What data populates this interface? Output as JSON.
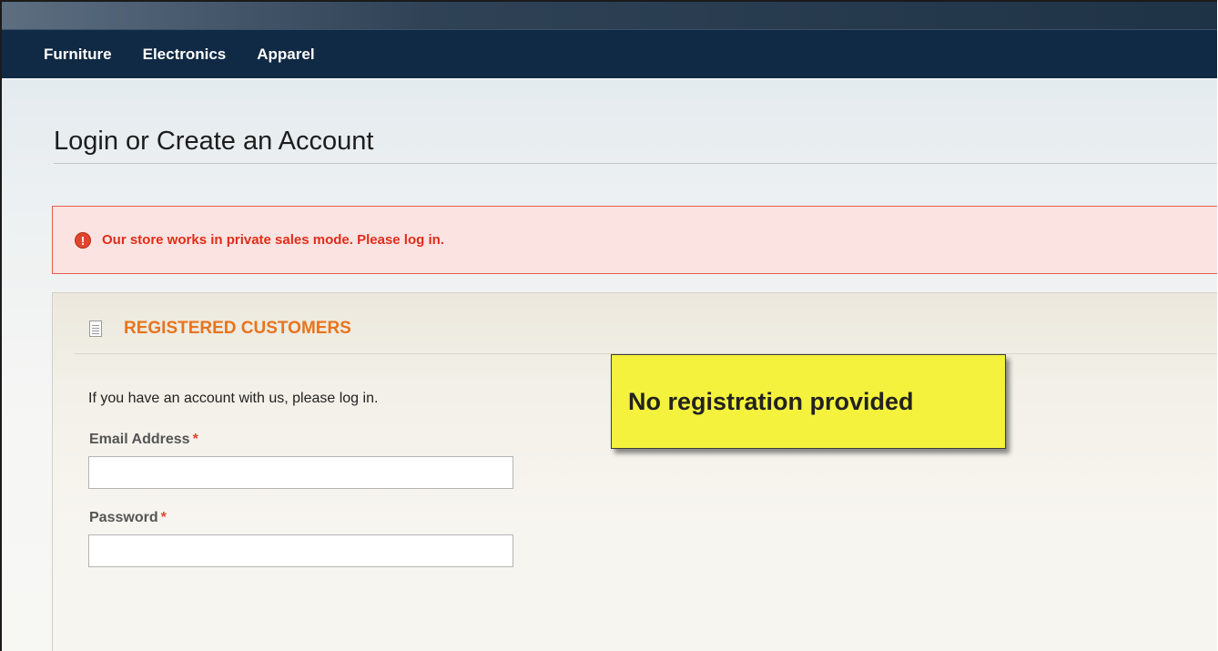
{
  "nav": {
    "items": [
      "Furniture",
      "Electronics",
      "Apparel"
    ]
  },
  "page": {
    "title": "Login or Create an Account"
  },
  "alert": {
    "icon": "error-icon",
    "icon_glyph": "!",
    "message": "Our store works in private sales mode. Please log in.",
    "color": "#e12c18"
  },
  "registered": {
    "icon": "document-icon",
    "title": "REGISTERED CUSTOMERS",
    "title_color": "#e8741c",
    "intro": "If you have an account with us, please log in.",
    "email_label": "Email Address",
    "email_value": "",
    "password_label": "Password",
    "password_value": "",
    "required_marker": "*"
  },
  "callout": {
    "text": "No registration provided",
    "color": "#f5f23d"
  }
}
